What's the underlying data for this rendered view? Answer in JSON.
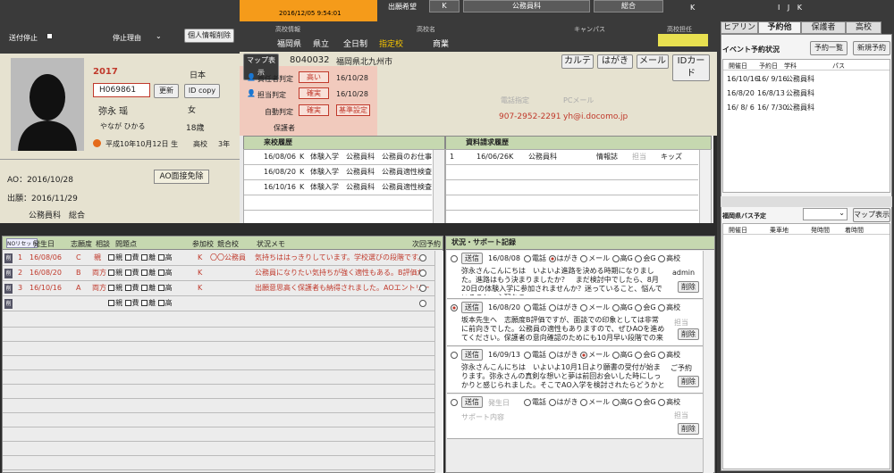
{
  "header": {
    "datetime": "2016/12/05 9:54:01",
    "hope_label": "出願希望",
    "hope_school": "K",
    "hope_course": "公務員科",
    "hope_extra": "総合",
    "hope_k": "K",
    "right_letters": "I J K"
  },
  "student": {
    "send_stop": "送付停止",
    "stop_reason": "停止理由",
    "delete_button": "個人情報削除",
    "year": "2017",
    "id": "H069861",
    "update": "更新",
    "id_copy": "ID copy",
    "name": "弥永 瑶",
    "kana": "やなが ひかる",
    "birth": "平成10年10月12日 生",
    "region": "日本",
    "gender": "女",
    "age": "18歳",
    "school_type": "高校",
    "grade": "3年",
    "ao": "AO：2016/10/28",
    "ao_button": "AO面接免除",
    "apply": "出願：2016/11/29",
    "dept": "公務員科　総合"
  },
  "school": {
    "info_label": "高校情報",
    "name_label": "高校名",
    "campus_label": "キャンパス",
    "teacher_label": "高校担任",
    "pref": "福岡県",
    "type1": "県立",
    "type2": "全日制",
    "designated": "指定校",
    "school": "商業",
    "map_button": "マップ表示",
    "zip": "8040032",
    "address": "福岡県北九州市",
    "karte": "カルテ",
    "postcard": "はがき",
    "mail": "メール",
    "idcard": "IDカード",
    "phone_label": "電話指定",
    "pcmail_label": "PCメール",
    "phone": "907-2952-2291",
    "email": "yh@i.docomo.jp",
    "guardian": "保護者"
  },
  "judge": [
    {
      "label": "責任者判定",
      "value": "高い",
      "date": "16/10/28"
    },
    {
      "label": "担当判定",
      "value": "確実",
      "date": "16/10/28"
    },
    {
      "label": "自動判定",
      "value": "確実",
      "extra": "基準設定"
    }
  ],
  "visit": {
    "title": "来校履歴",
    "rows": [
      [
        "16/08/06",
        "K",
        "体験入学",
        "公務員科",
        "公務員のお仕事"
      ],
      [
        "16/08/20",
        "K",
        "体験入学",
        "公務員科",
        "公務員適性検査"
      ],
      [
        "16/10/16",
        "K",
        "体験入学",
        "公務員科",
        "公務員適性検査"
      ]
    ]
  },
  "docs": {
    "title": "資料請求履歴",
    "rows": [
      [
        "1",
        "16/06/26",
        "K",
        "公務員科",
        "情報誌",
        "担当",
        "キッズ"
      ]
    ]
  },
  "table": {
    "headers": [
      "NOリセット",
      "発生日",
      "志願度",
      "相談",
      "問題点",
      "参加校",
      "競合校",
      "状況メモ",
      "次回予約"
    ],
    "checks": [
      "親",
      "費",
      "離",
      "高"
    ],
    "rows": [
      {
        "n": "1",
        "date": "16/08/06",
        "grade": "C",
        "who": "親",
        "school": "K",
        "rival": "〇〇公務員",
        "memo": "気持ちははっきりしています。学校選びの段階です。"
      },
      {
        "n": "2",
        "date": "16/08/20",
        "grade": "B",
        "who": "両方",
        "school": "K",
        "rival": "",
        "memo": "公務員になりたい気持ちが強く適性もある。B評価だ"
      },
      {
        "n": "3",
        "date": "16/10/16",
        "grade": "A",
        "who": "両方",
        "school": "K",
        "rival": "",
        "memo": "出願意思高く保護者も納得されました。AOエントリー"
      }
    ]
  },
  "support": {
    "title": "状況・サポート記録",
    "send": "送信",
    "delete": "削除",
    "channels": [
      "電話",
      "はがき",
      "メール",
      "高G",
      "会G",
      "高校"
    ],
    "records": [
      {
        "date": "16/08/08",
        "sel": 1,
        "text": "弥永さんこんにちは　いよいよ進路を決める時期になりました。進路はもう決まりましたか？　まだ検討中でしたら、8月20日の体験入学に参加されませんか？迷っていること、悩んでいること、心配なこ",
        "who": "admin"
      },
      {
        "date": "16/08/20",
        "sel": -1,
        "text": "坂本先生へ　志願度B評価ですが、面談での印象としては非常に前向きでした。公務員の適性もありますので、ぜひAOを進めてください。保護者の意向確認のためにも10月早い段階での来校促進を",
        "who": "担当"
      },
      {
        "date": "16/09/13",
        "sel": 2,
        "text": "弥永さんこんにちは　いよいよ10月1日より願書の受付が始まります。弥永さんの真剣な想いと夢は前回お会いした時にしっかりと感じられました。そこでAO入学を検討されたらどうかとメールしまし",
        "who": "ご予約"
      },
      {
        "date": "発生日",
        "sel": -1,
        "text": "サポート内容",
        "who": "担当"
      }
    ]
  },
  "right": {
    "tabs": [
      "ヒアリン",
      "予約他",
      "保護者",
      "高校"
    ],
    "event_title": "イベント予約状況",
    "reserve_list": "予約一覧",
    "new_reserve": "新規予約",
    "event_headers": [
      "開催日",
      "予約日",
      "学科",
      "パス"
    ],
    "events": [
      [
        "16/10/16",
        "16/ 9/16",
        "公務員科"
      ],
      [
        "16/8/20",
        "16/8/13",
        "公務員科"
      ],
      [
        "16/ 8/ 6",
        "16/ 7/30",
        "公務員科"
      ]
    ],
    "bus_title": "福岡県バス予定",
    "map_button": "マップ表示",
    "bus_headers": [
      "開催日",
      "乗車地",
      "発時間",
      "着時間"
    ]
  }
}
